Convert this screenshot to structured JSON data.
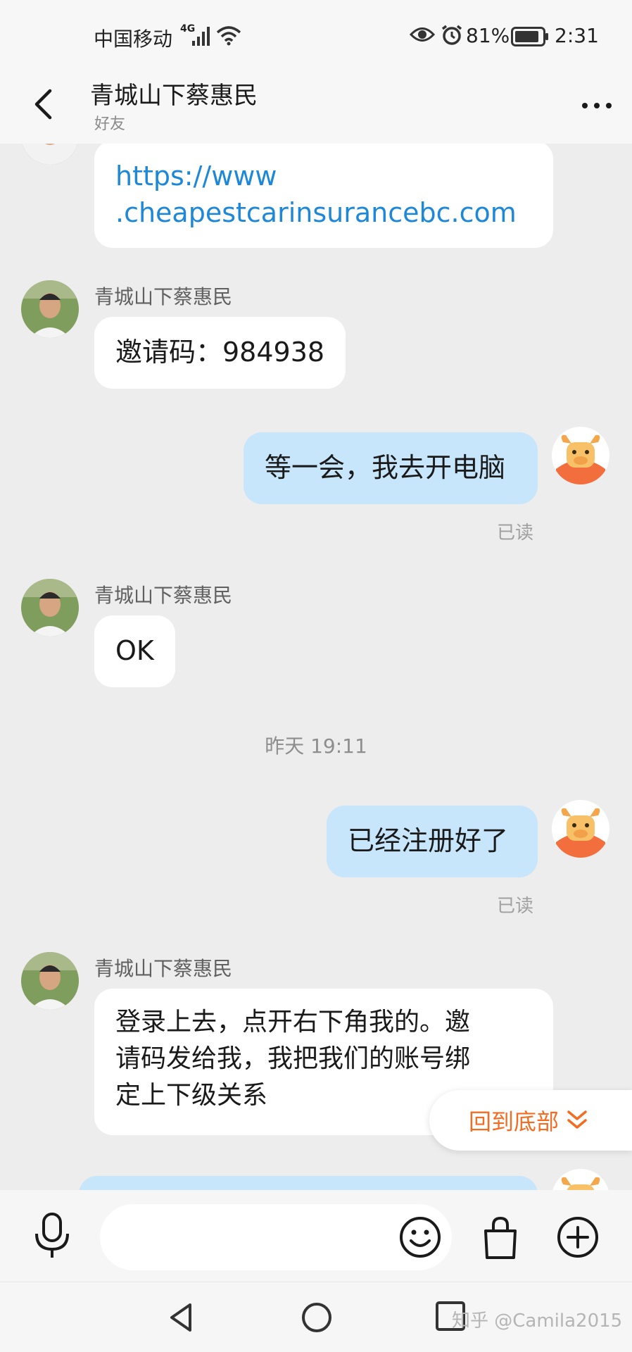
{
  "status_bar": {
    "carrier": "中国移动",
    "network": "4G",
    "battery": "81%",
    "time": "2:31"
  },
  "header": {
    "title": "青城山下蔡惠民",
    "subtitle": "好友",
    "back_icon": "chevron-left-icon",
    "more_icon": "more-dots-icon"
  },
  "messages": [
    {
      "direction": "in",
      "text_line1": "https://www",
      "text_line2": ".cheapestcarinsurancebc.com",
      "kind": "link"
    },
    {
      "direction": "in",
      "sender": "青城山下蔡惠民",
      "text": "邀请码：984938"
    },
    {
      "direction": "out",
      "text": "等一会，我去开电脑",
      "status": "已读"
    },
    {
      "direction": "in",
      "sender": "青城山下蔡惠民",
      "text": "OK"
    },
    {
      "timestamp": "昨天  19:11"
    },
    {
      "direction": "out",
      "text": "已经注册好了",
      "status": "已读"
    },
    {
      "direction": "in",
      "sender": "青城山下蔡惠民",
      "lines": [
        "登录上去，点开右下角我的。邀",
        "请码发给我，我把我们的账号绑",
        "定上下级关系"
      ]
    }
  ],
  "back_to_bottom": {
    "label": "回到底部",
    "icon": "double-chevron-down-icon"
  },
  "input_bar": {
    "placeholder": "",
    "value": ""
  },
  "watermark": "知乎 @Camila2015",
  "colors": {
    "incoming_bubble": "#ffffff",
    "outgoing_bubble": "#c7e5fb",
    "link": "#1e88d8",
    "accent_orange": "#f36c21",
    "background": "#ededed"
  }
}
